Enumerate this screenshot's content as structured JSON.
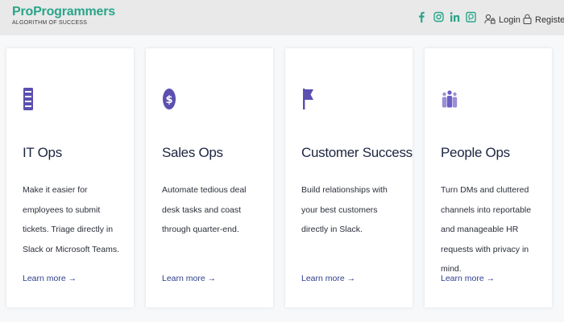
{
  "header": {
    "brand_name": "ProProgrammers",
    "brand_tagline": "ALGORITHM OF SUCCESS",
    "social_icons": [
      "facebook-icon",
      "instagram-icon",
      "linkedin-icon",
      "whatsapp-icon"
    ],
    "login_label": "Login",
    "register_label": "Register",
    "accent_color": "#2aa58a"
  },
  "cards": [
    {
      "icon": "server-icon",
      "title": "IT Ops",
      "description": "Make it easier for employees to submit tickets. Triage directly in Slack or Microsoft Teams.",
      "link": "Learn more →"
    },
    {
      "icon": "dollar-icon",
      "title": "Sales Ops",
      "description": "Automate tedious deal desk tasks and coast through quarter-end.",
      "link": "Learn more →"
    },
    {
      "icon": "flag-icon",
      "title": "Customer Success",
      "description": "Build relationships with your best customers directly in Slack.",
      "link": "Learn more →"
    },
    {
      "icon": "people-icon",
      "title": "People Ops",
      "description": "Turn DMs and cluttered channels into reportable and manageable HR requests with privacy in mind.",
      "link": "Learn more →"
    }
  ],
  "colors": {
    "icon_purple": "#5b4fb0",
    "link_blue": "#2d3f8c"
  }
}
